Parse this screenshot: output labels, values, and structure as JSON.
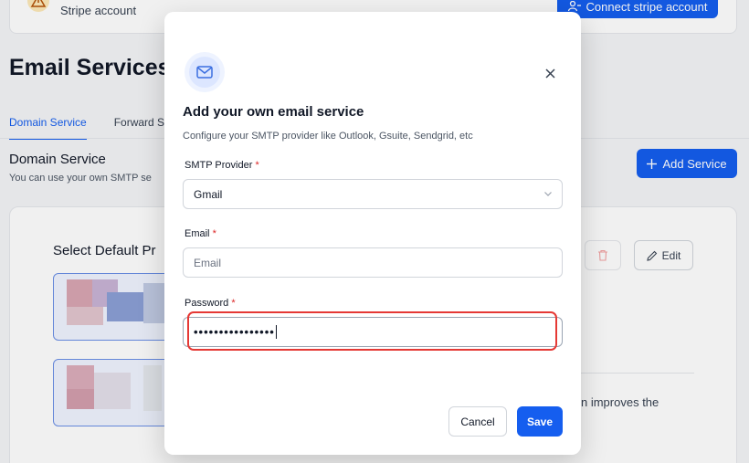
{
  "background": {
    "stripe_card": {
      "text": "Stripe account",
      "connect_label": "Connect stripe account"
    },
    "page_title": "Email Services",
    "tabs": [
      {
        "label": "Domain Service",
        "active": true
      },
      {
        "label": "Forward S",
        "active": false
      }
    ],
    "section": {
      "title": "Domain Service",
      "subtitle": "You can use your own SMTP se"
    },
    "add_service_label": "Add Service",
    "default_title": "Select Default Pr",
    "edit_label": "Edit",
    "improves_text": "n improves the",
    "icons": {
      "warning": "warning-triangle-icon",
      "user_link": "user-link-icon",
      "plus": "plus-icon",
      "trash": "trash-icon",
      "pencil": "pencil-icon"
    }
  },
  "modal": {
    "icon": "mail-icon",
    "title": "Add your own email service",
    "subtitle": "Configure your SMTP provider like Outlook, Gsuite, Sendgrid, etc",
    "fields": {
      "provider": {
        "label": "SMTP Provider",
        "value": "Gmail"
      },
      "email": {
        "label": "Email",
        "placeholder": "Email",
        "value": ""
      },
      "password": {
        "label": "Password",
        "value": "••••••••••••••••"
      }
    },
    "required_mark": "*",
    "cancel_label": "Cancel",
    "save_label": "Save",
    "close_icon": "close-icon"
  },
  "colors": {
    "primary": "#155eef",
    "required": "#dc2626",
    "highlight": "#e53935"
  }
}
